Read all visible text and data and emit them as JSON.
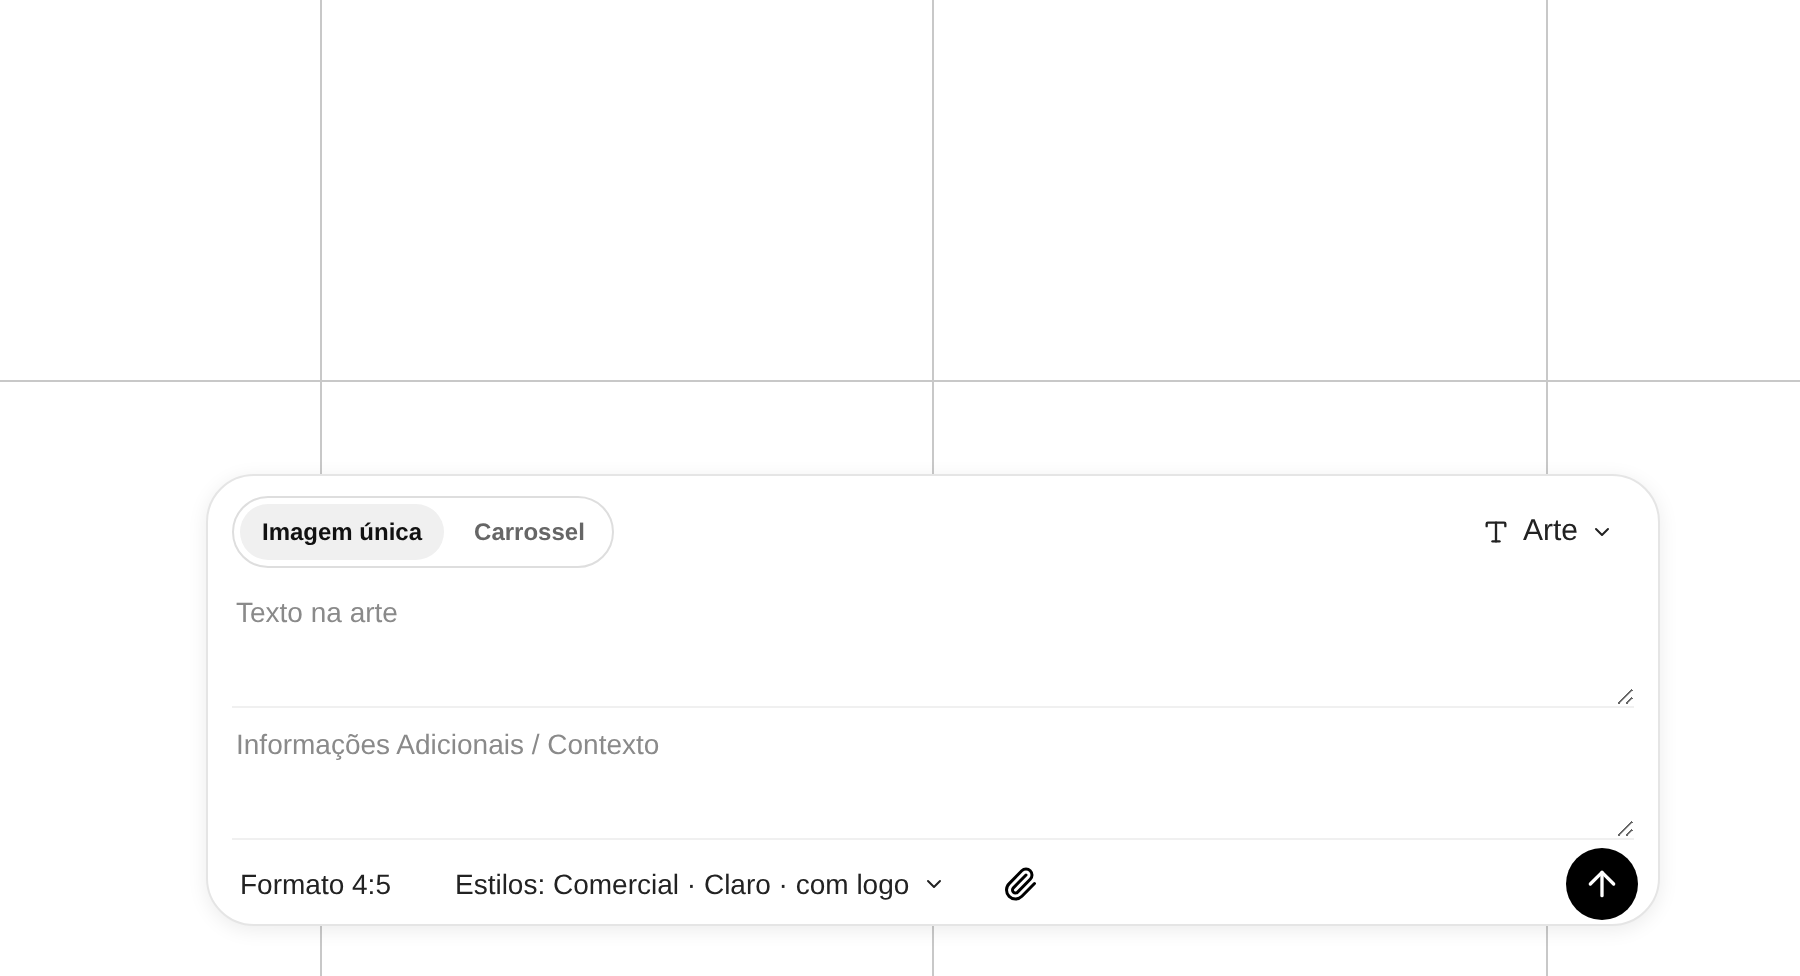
{
  "mode_tabs": [
    {
      "label": "Imagem única",
      "selected": true
    },
    {
      "label": "Carrossel",
      "selected": false
    }
  ],
  "type_menu": {
    "label": "Arte"
  },
  "fields": [
    {
      "placeholder": "Texto na arte"
    },
    {
      "placeholder": "Informações Adicionais / Contexto"
    }
  ],
  "toolbar": {
    "format": "Formato 4:5",
    "styles": "Estilos: Comercial · Claro · com logo"
  }
}
